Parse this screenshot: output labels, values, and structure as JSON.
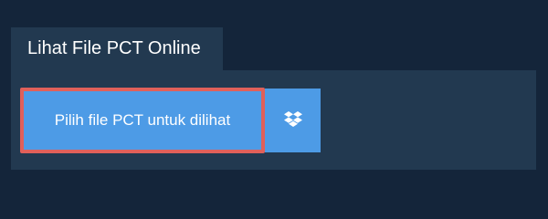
{
  "tab": {
    "title": "Lihat File PCT Online"
  },
  "actions": {
    "upload_label": "Pilih file PCT untuk dilihat",
    "dropbox_icon": "dropbox-icon"
  },
  "colors": {
    "page_background": "#14253a",
    "panel_background": "#223950",
    "button_background": "#4d9be6",
    "focus_outline": "#e0605a",
    "text": "#ffffff"
  }
}
